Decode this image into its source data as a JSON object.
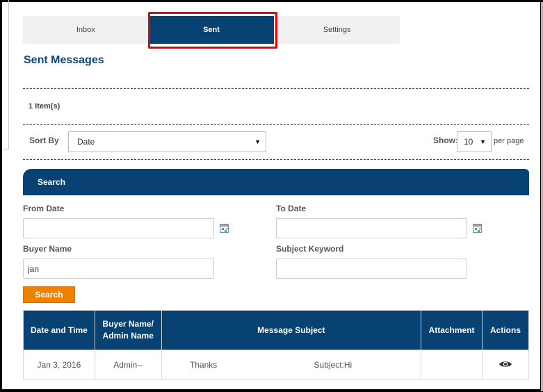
{
  "tabs": [
    {
      "label": "Inbox",
      "active": false
    },
    {
      "label": "Sent",
      "active": true
    },
    {
      "label": "Settings",
      "active": false
    }
  ],
  "page_title": "Sent Messages",
  "items_count": "1 Item(s)",
  "sort": {
    "label": "Sort By",
    "selected": "Date"
  },
  "show": {
    "label": "Show:",
    "selected": "10",
    "suffix": "per page"
  },
  "search_panel": {
    "title": "Search",
    "from_date": {
      "label": "From Date",
      "value": "",
      "icon": "calendar-icon"
    },
    "to_date": {
      "label": "To Date",
      "value": "",
      "icon": "calendar-icon"
    },
    "buyer_name": {
      "label": "Buyer Name",
      "value": "jan"
    },
    "subject_keyword": {
      "label": "Subject Keyword",
      "value": ""
    },
    "search_button": "Search"
  },
  "table": {
    "headers": {
      "date_time": "Date and Time",
      "buyer_line1": "Buyer Name/",
      "buyer_line2": "Admin Name",
      "subject": "Message Subject",
      "attachment": "Attachment",
      "actions": "Actions"
    },
    "rows": [
      {
        "date": "Jan 3, 2016",
        "name": "Admin--",
        "message": "Thanks",
        "subject": "Subject:Hi",
        "attachment": "",
        "action_icon": "eye-icon"
      }
    ]
  },
  "colors": {
    "primary": "#084273",
    "accent": "#f08100",
    "highlight": "#e8000b"
  }
}
